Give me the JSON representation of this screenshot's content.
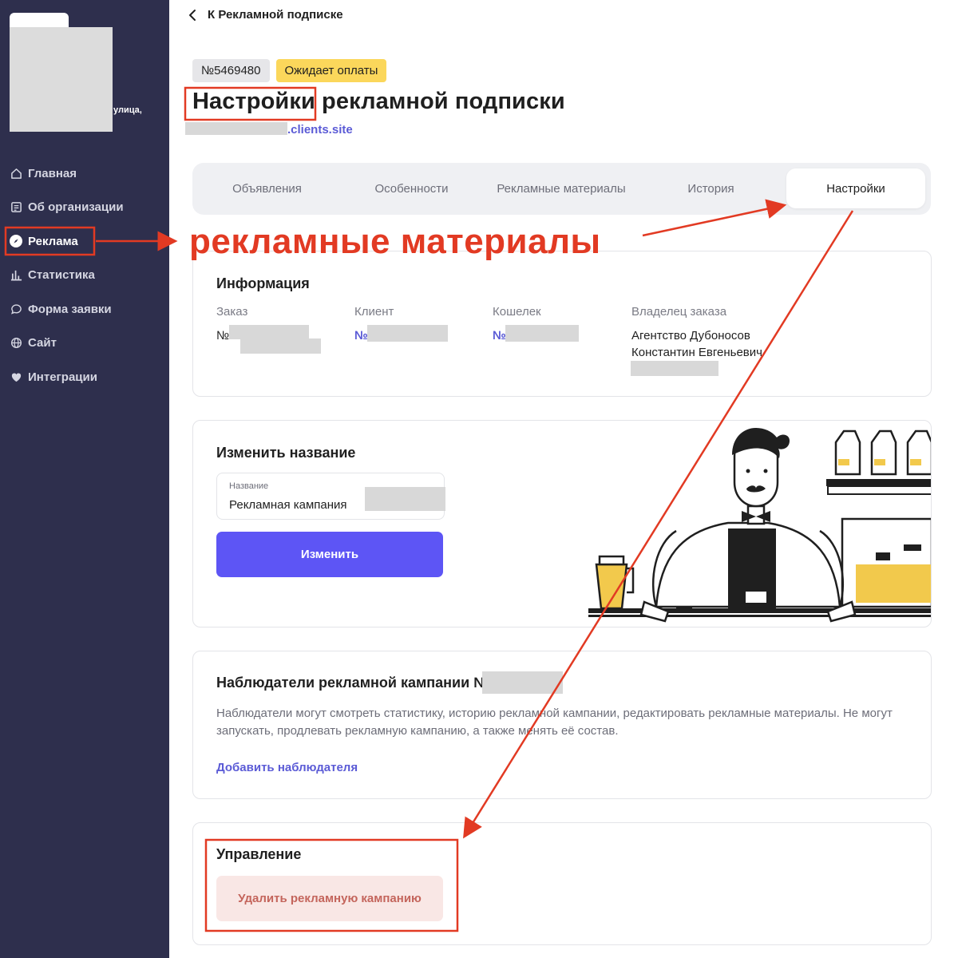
{
  "sidebar": {
    "org_street": "улица,",
    "items": [
      {
        "label": "Главная",
        "icon": "home-icon"
      },
      {
        "label": "Об организации",
        "icon": "document-icon"
      },
      {
        "label": "Реклама",
        "icon": "compass-icon",
        "active": true
      },
      {
        "label": "Статистика",
        "icon": "bar-chart-icon"
      },
      {
        "label": "Форма заявки",
        "icon": "speech-bubble-icon"
      },
      {
        "label": "Сайт",
        "icon": "globe-icon"
      },
      {
        "label": "Интеграции",
        "icon": "heart-icon"
      }
    ]
  },
  "header": {
    "back_label": "К Рекламной подписке",
    "order_id": "№5469480",
    "status": "Ожидает оплаты",
    "title": "Настройки рекламной подписки",
    "site_domain": ".clients.site"
  },
  "tabs": [
    {
      "label": "Объявления"
    },
    {
      "label": "Особенности"
    },
    {
      "label": "Рекламные материалы"
    },
    {
      "label": "История"
    },
    {
      "label": "Настройки",
      "active": true
    }
  ],
  "info": {
    "title": "Информация",
    "order": {
      "label": "Заказ",
      "value": "№"
    },
    "client": {
      "label": "Клиент",
      "value": "№"
    },
    "wallet": {
      "label": "Кошелек",
      "value": "№"
    },
    "owner": {
      "label": "Владелец заказа",
      "line1": "Агентство Дубоносов",
      "line2": "Константин Евгеньевич"
    }
  },
  "rename": {
    "title": "Изменить название",
    "field_label": "Название",
    "field_value": "Рекламная кампания",
    "button": "Изменить"
  },
  "observers": {
    "title": "Наблюдатели рекламной кампании №",
    "description": "Наблюдатели могут смотреть статистику, историю рекламной кампании, редактировать рекламные материалы. Не могут запускать, продлевать рекламную кампанию, а также менять её состав.",
    "add_link": "Добавить наблюдателя"
  },
  "management": {
    "title": "Управление",
    "delete_button": "Удалить рекламную кампанию"
  },
  "annotation": {
    "caption": "рекламные материалы",
    "color": "#e23a23"
  },
  "colors": {
    "sidebar_bg": "#2e2f4d",
    "primary": "#5d55f5",
    "link": "#5b5bd6",
    "status_badge": "#fbd75b",
    "danger_bg": "#f9e7e5"
  }
}
